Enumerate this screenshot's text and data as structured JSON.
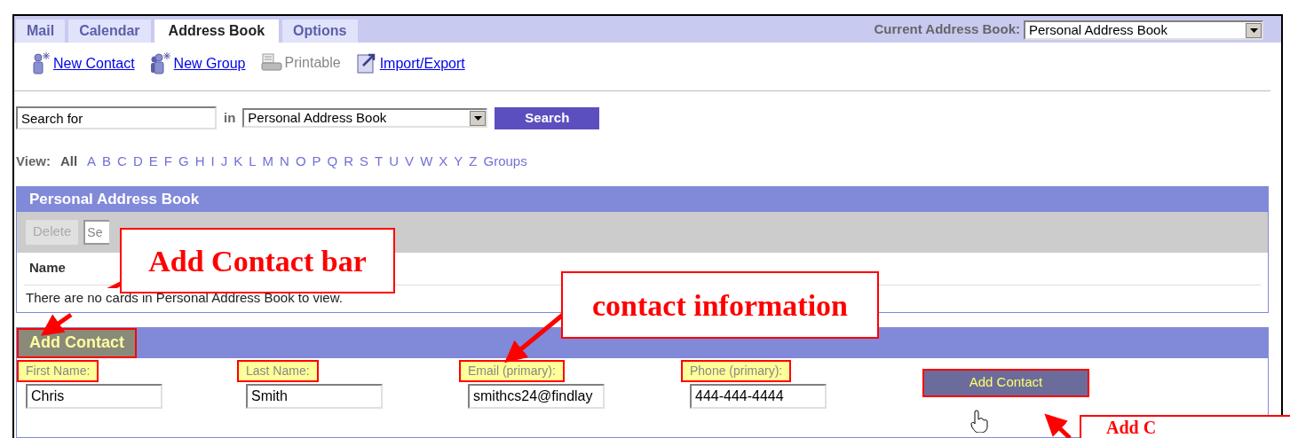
{
  "tabs": [
    {
      "label": "Mail",
      "selected": false
    },
    {
      "label": "Calendar",
      "selected": false
    },
    {
      "label": "Address Book",
      "selected": true
    },
    {
      "label": "Options",
      "selected": false
    }
  ],
  "current_address_book": {
    "label": "Current Address Book:",
    "value": "Personal Address Book"
  },
  "toolbar": [
    {
      "label": "New Contact",
      "disabled": false,
      "kind": "contact"
    },
    {
      "label": "New Group",
      "disabled": false,
      "kind": "group"
    },
    {
      "label": "Printable",
      "disabled": true,
      "kind": "print"
    },
    {
      "label": "Import/Export",
      "disabled": false,
      "kind": "import"
    }
  ],
  "search": {
    "value": "Search for",
    "in_label": "in",
    "scope": "Personal Address Book",
    "button": "Search"
  },
  "view": {
    "label": "View:",
    "items": [
      {
        "label": "All",
        "selected": true
      },
      {
        "label": "A",
        "selected": false
      },
      {
        "label": "B",
        "selected": false
      },
      {
        "label": "C",
        "selected": false
      },
      {
        "label": "D",
        "selected": false
      },
      {
        "label": "E",
        "selected": false
      },
      {
        "label": "F",
        "selected": false
      },
      {
        "label": "G",
        "selected": false
      },
      {
        "label": "H",
        "selected": false
      },
      {
        "label": "I",
        "selected": false
      },
      {
        "label": "J",
        "selected": false
      },
      {
        "label": "K",
        "selected": false
      },
      {
        "label": "L",
        "selected": false
      },
      {
        "label": "M",
        "selected": false
      },
      {
        "label": "N",
        "selected": false
      },
      {
        "label": "O",
        "selected": false
      },
      {
        "label": "P",
        "selected": false
      },
      {
        "label": "Q",
        "selected": false
      },
      {
        "label": "R",
        "selected": false
      },
      {
        "label": "S",
        "selected": false
      },
      {
        "label": "T",
        "selected": false
      },
      {
        "label": "U",
        "selected": false
      },
      {
        "label": "V",
        "selected": false
      },
      {
        "label": "W",
        "selected": false
      },
      {
        "label": "X",
        "selected": false
      },
      {
        "label": "Y",
        "selected": false
      },
      {
        "label": "Z",
        "selected": false
      },
      {
        "label": "Groups",
        "selected": false
      }
    ]
  },
  "address_book_panel": {
    "title": "Personal Address Book",
    "delete_button": {
      "label": "Delete",
      "disabled": true
    },
    "filter_placeholder": "Se",
    "columns": [
      "Name"
    ],
    "empty_message": "There are no cards in Personal Address Book to view."
  },
  "add_contact_panel": {
    "title": "Add Contact",
    "title_highlighted": true,
    "fields": [
      {
        "label": "First Name:",
        "value": "Chris",
        "highlighted": true
      },
      {
        "label": "Last Name:",
        "value": "Smith",
        "highlighted": true
      },
      {
        "label": "Email (primary):",
        "value": "smithcs24@findlay",
        "highlighted": true
      },
      {
        "label": "Phone (primary):",
        "value": "444-444-4444",
        "highlighted": true
      }
    ],
    "button": {
      "label": "Add Contact",
      "highlighted": true
    }
  },
  "callouts": [
    {
      "text": "Add Contact bar"
    },
    {
      "text": "contact information"
    },
    {
      "text": "Add C"
    }
  ]
}
